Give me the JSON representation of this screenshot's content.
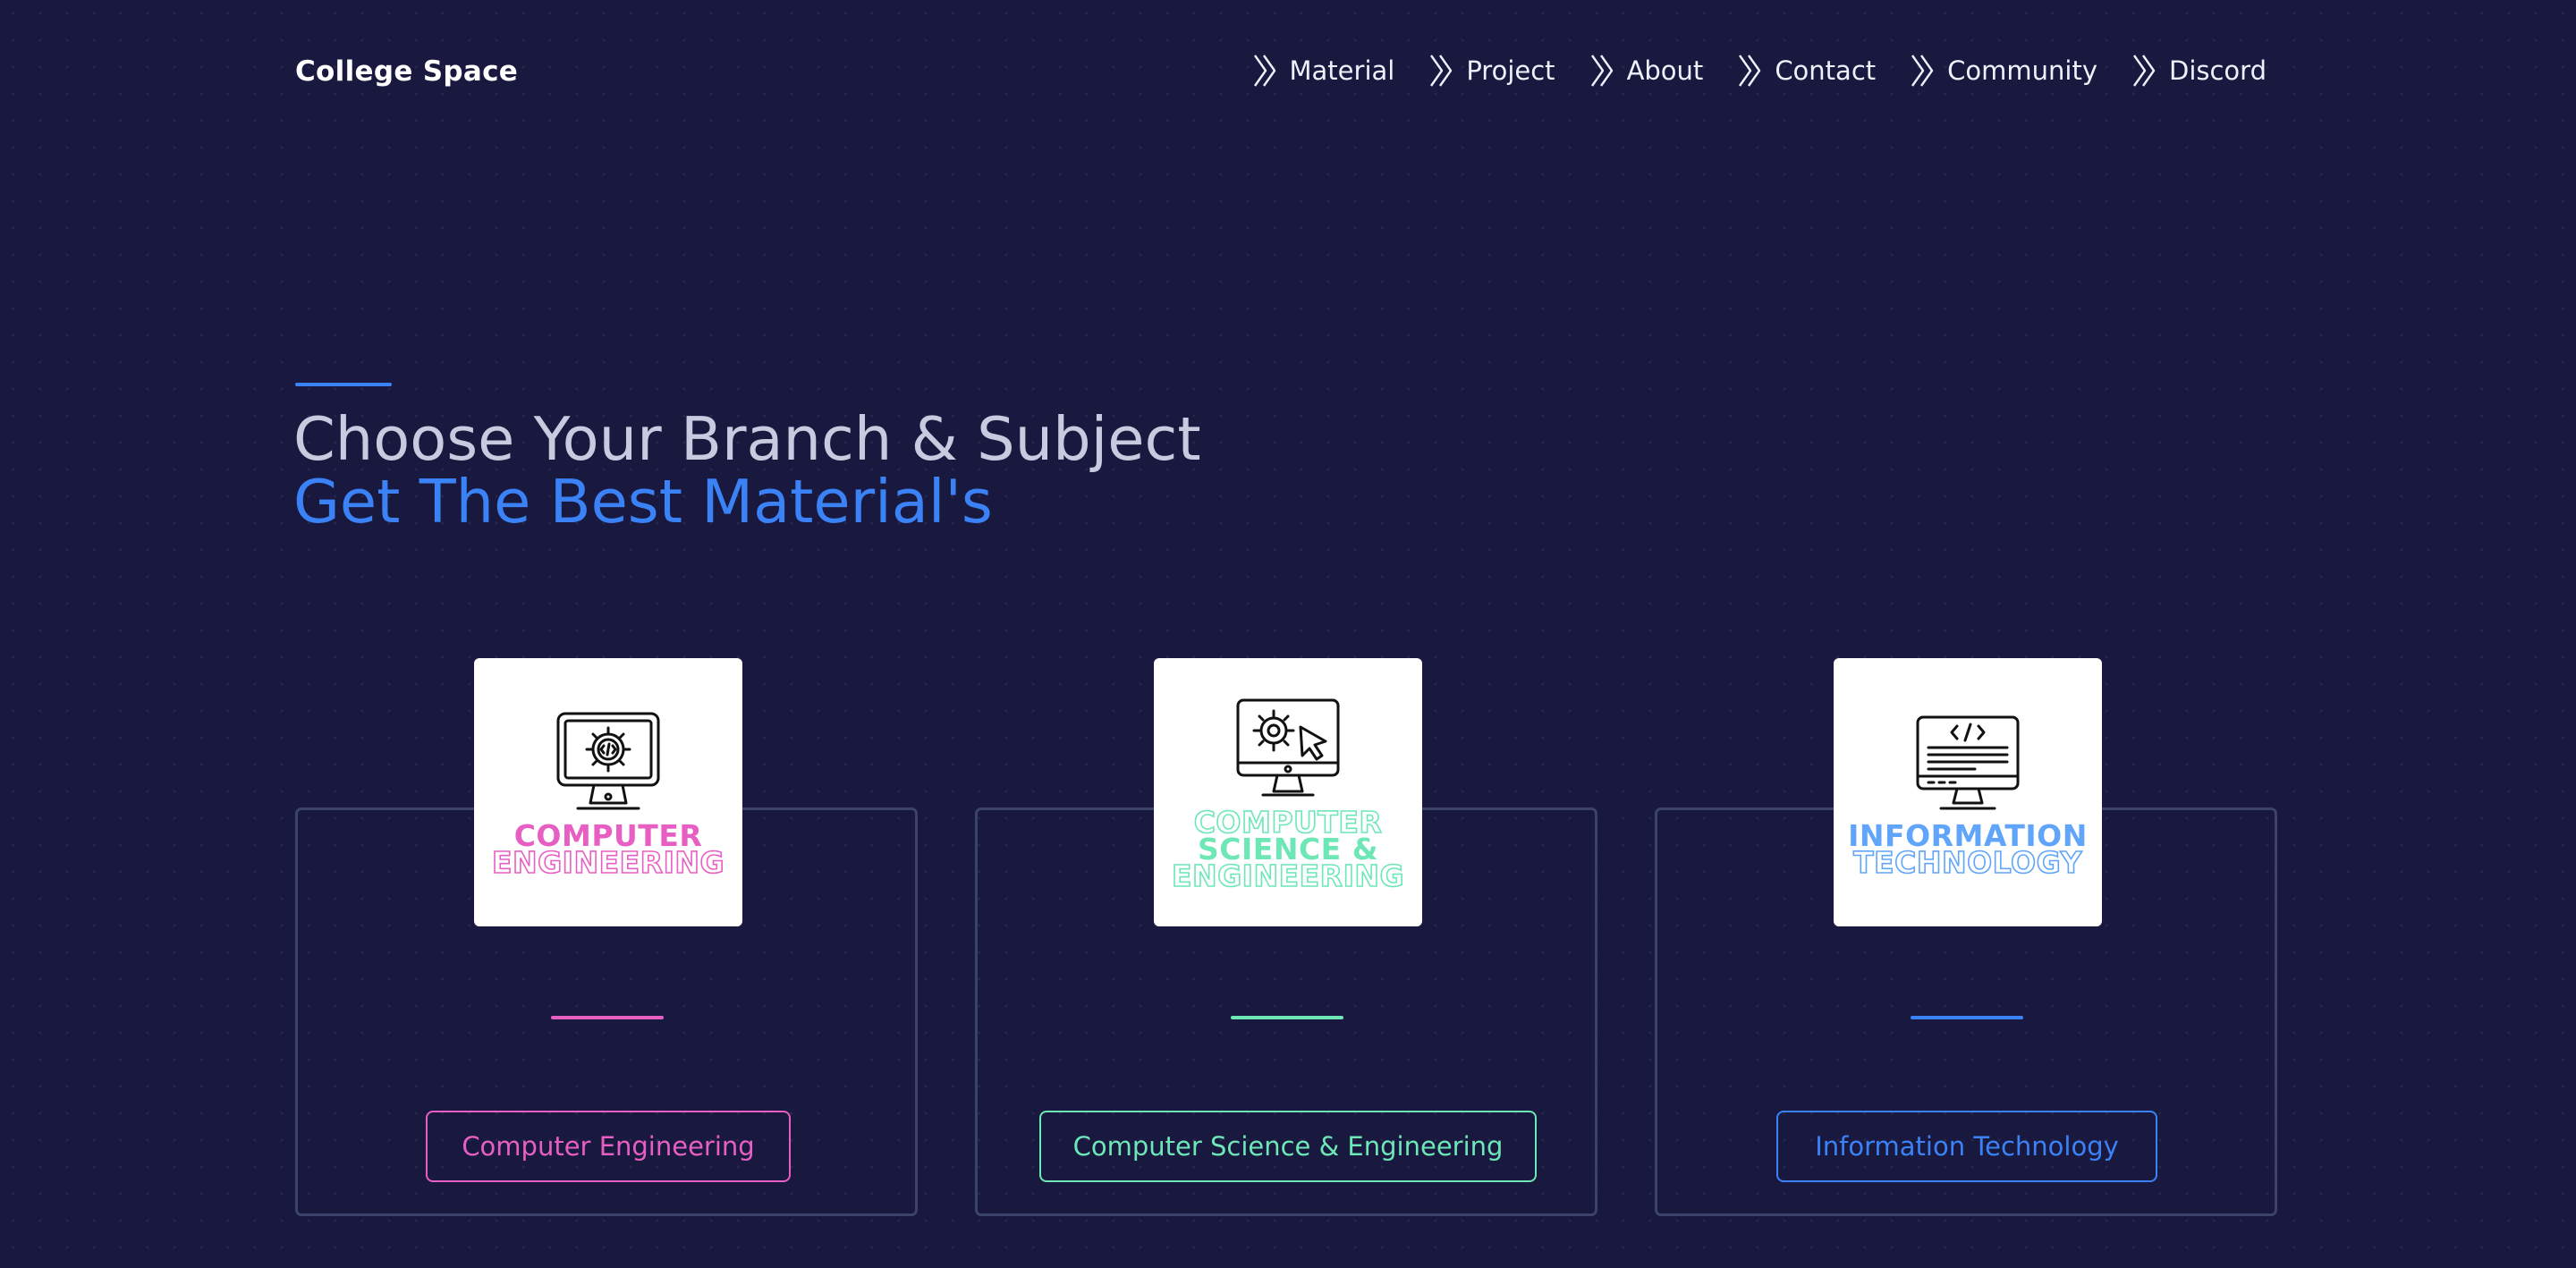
{
  "brand": "College Space",
  "nav": [
    {
      "label": "Material"
    },
    {
      "label": "Project"
    },
    {
      "label": "About"
    },
    {
      "label": "Contact"
    },
    {
      "label": "Community"
    },
    {
      "label": "Discord"
    }
  ],
  "hero": {
    "line1": "Choose Your Branch & Subject",
    "line2": "Get The Best Material's",
    "accent_color": "#3b82f6"
  },
  "branches": [
    {
      "thumb_lines": [
        "COMPUTER",
        "ENGINEERING"
      ],
      "button_label": "Computer Engineering",
      "color": "#e85fc4",
      "icon": "monitor-code-gear-icon"
    },
    {
      "thumb_lines": [
        "COMPUTER",
        "SCIENCE &",
        "ENGINEERING"
      ],
      "button_label": "Computer Science & Engineering",
      "color": "#6ee7b7",
      "icon": "monitor-gear-cursor-icon"
    },
    {
      "thumb_lines": [
        "INFORMATION",
        "TECHNOLOGY"
      ],
      "button_label": "Information Technology",
      "color": "#3b82f6",
      "icon": "monitor-code-document-icon"
    }
  ]
}
